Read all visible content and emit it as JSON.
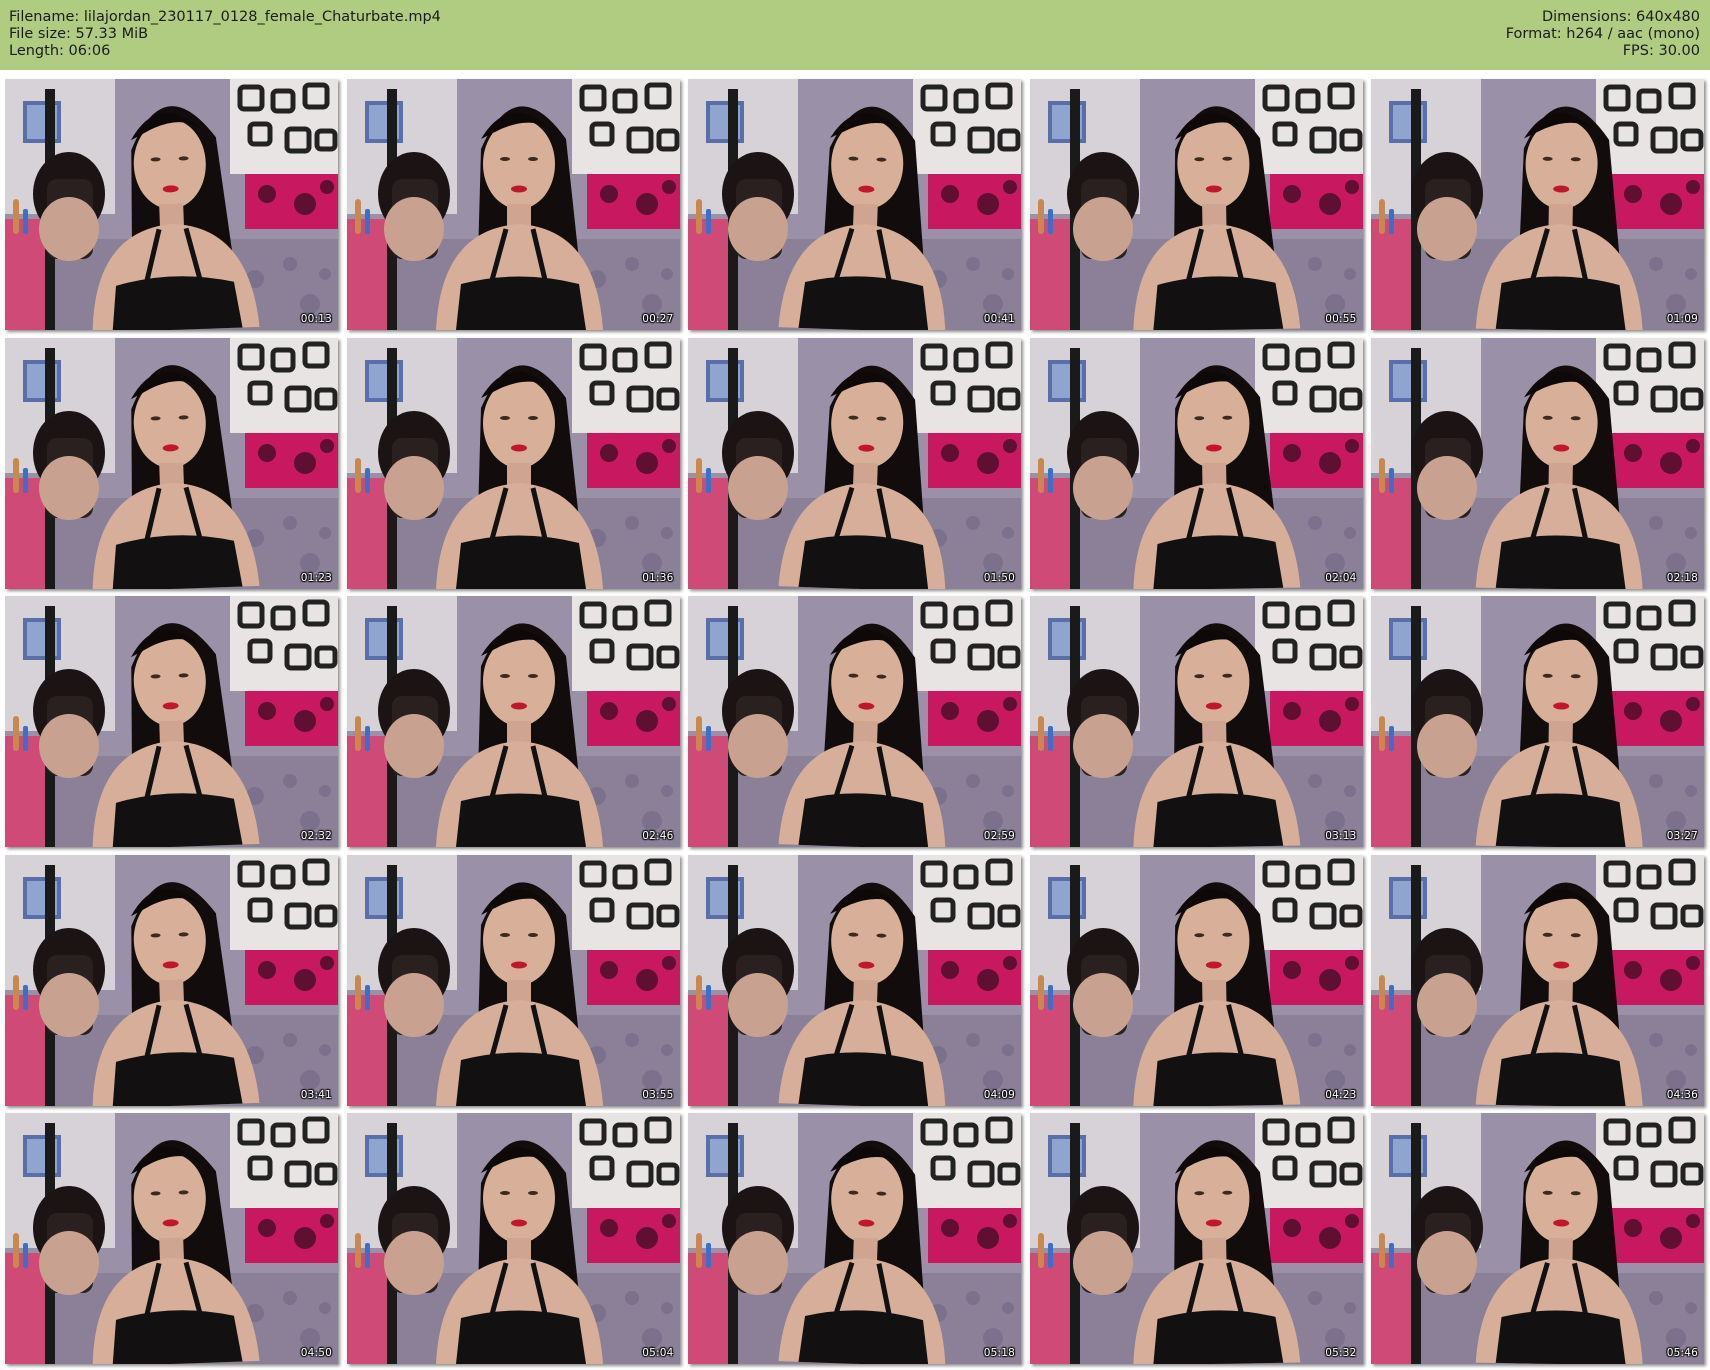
{
  "header": {
    "filename": "Filename: lilajordan_230117_0128_female_Chaturbate.mp4",
    "filesize": "File size: 57.33 MiB",
    "length": "Length: 06:06",
    "dimensions": "Dimensions: 640x480",
    "format": "Format: h264 / aac (mono)",
    "fps": "FPS: 30.00"
  },
  "thumbnails": [
    {
      "timestamp": "00:13"
    },
    {
      "timestamp": "00:27"
    },
    {
      "timestamp": "00:41"
    },
    {
      "timestamp": "00:55"
    },
    {
      "timestamp": "01:09"
    },
    {
      "timestamp": "01:23"
    },
    {
      "timestamp": "01:36"
    },
    {
      "timestamp": "01:50"
    },
    {
      "timestamp": "02:04"
    },
    {
      "timestamp": "02:18"
    },
    {
      "timestamp": "02:32"
    },
    {
      "timestamp": "02:46"
    },
    {
      "timestamp": "02:59"
    },
    {
      "timestamp": "03:13"
    },
    {
      "timestamp": "03:27"
    },
    {
      "timestamp": "03:41"
    },
    {
      "timestamp": "03:55"
    },
    {
      "timestamp": "04:09"
    },
    {
      "timestamp": "04:23"
    },
    {
      "timestamp": "04:36"
    },
    {
      "timestamp": "04:50"
    },
    {
      "timestamp": "05:04"
    },
    {
      "timestamp": "05:18"
    },
    {
      "timestamp": "05:32"
    },
    {
      "timestamp": "05:46"
    }
  ],
  "colors": {
    "header_bg": "#b0cc80",
    "header_text": "#1c1c1c",
    "page_bg": "#ffffff"
  }
}
